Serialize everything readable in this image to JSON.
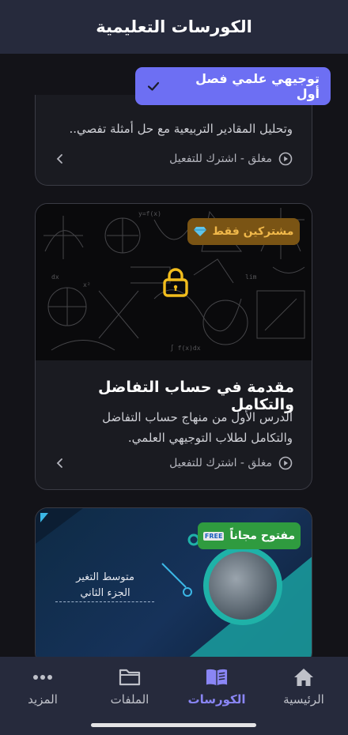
{
  "header": {
    "title": "الكورسات التعليمية"
  },
  "filter": {
    "label": "توجيهي علمي فصل أول",
    "icon": "check-icon"
  },
  "courses": [
    {
      "description_partial": "وتحليل المقادير التربيعية مع حل أمثلة تفصي..",
      "status": "مغلق - اشترك للتفعيل"
    },
    {
      "badge": "مشتركين فقط",
      "badge_icon": "diamond-icon",
      "title": "مقدمة في حساب التفاضل والتكامل",
      "description_line1": "الدرس الأول من منهاج حساب التفاضل",
      "description_line2": "والتكامل لطلاب التوجيهي العلمي.",
      "status": "مغلق - اشترك للتفعيل"
    },
    {
      "badge": "مفتوح مجاناً",
      "badge_icon_text": "FREE",
      "thumb_line1": "متوسط التغير",
      "thumb_line2": "الجزء الثاني"
    }
  ],
  "nav": {
    "home": "الرئيسية",
    "courses": "الكورسات",
    "files": "الملفات",
    "more": "المزيد"
  },
  "colors": {
    "accent": "#6d6ff3",
    "nav_active": "#8a86f5",
    "locked": "#f0b84a",
    "free": "#2f9b3f"
  }
}
